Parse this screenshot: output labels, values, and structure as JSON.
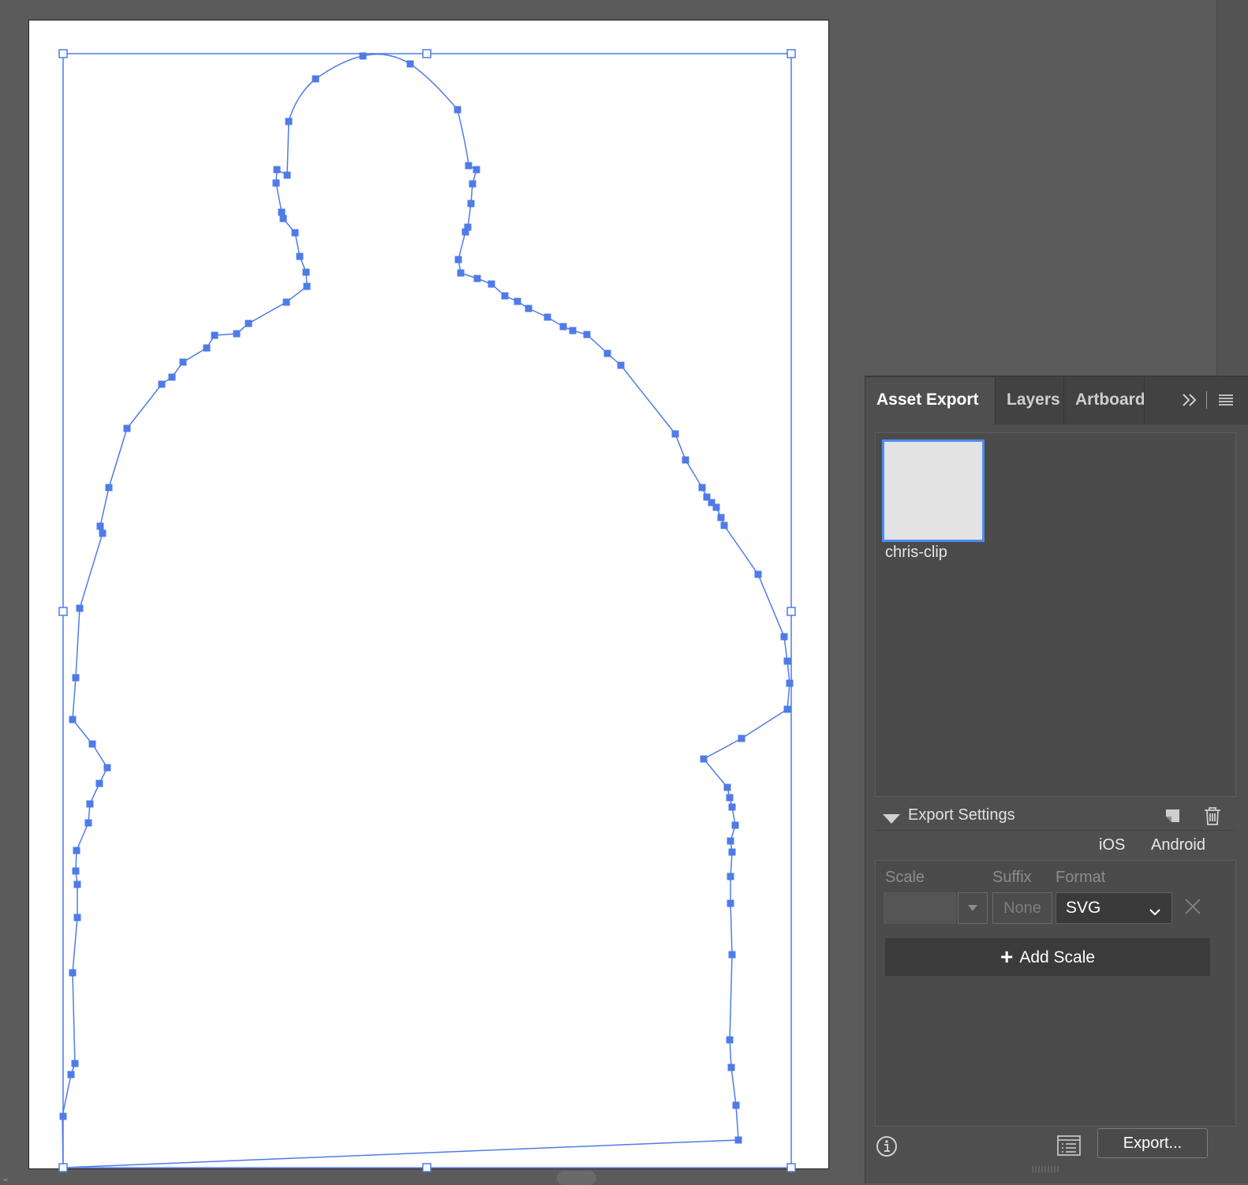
{
  "panel": {
    "tabs": [
      {
        "label": "Asset Export",
        "active": true
      },
      {
        "label": "Layers",
        "active": false
      },
      {
        "label": "Artboards",
        "active": false
      }
    ],
    "overflow_icon": "double-chevron-right-icon",
    "menu_icon": "hamburger-menu-icon"
  },
  "asset": {
    "name": "chris-clip",
    "selected_color": "#4e8cf0"
  },
  "export_settings": {
    "title": "Export Settings",
    "platforms": [
      "iOS",
      "Android"
    ],
    "columns": {
      "scale": "Scale",
      "suffix": "Suffix",
      "format": "Format"
    },
    "row": {
      "scale": "",
      "suffix_placeholder": "None",
      "format": "SVG"
    },
    "add_scale_label": "Add Scale",
    "export_label": "Export..."
  },
  "colors": {
    "selection": "#4f7be8",
    "panel_bg": "#4f4f4f",
    "canvas_bg": "#5b5b5b"
  }
}
